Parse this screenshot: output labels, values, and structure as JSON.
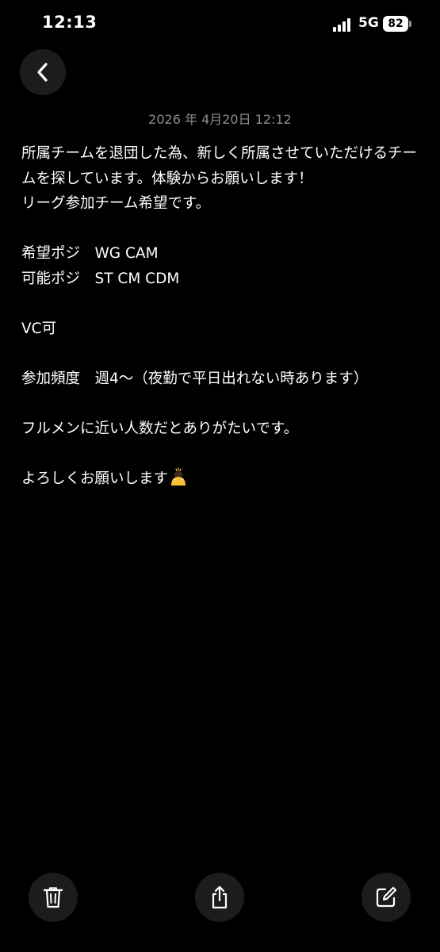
{
  "status_bar": {
    "time": "12:13",
    "network": "5G",
    "battery": "82"
  },
  "note": {
    "date": "2026 年 4月20日 12:12",
    "lines": [
      "所属チームを退団した為、新しく所属させていただけるチームを探しています。体験からお願いします！",
      "リーグ参加チーム希望です。",
      "希望ポジ　WG CAM",
      "可能ポジ　ST CM CDM",
      "VC可",
      "参加頻度　週4〜（夜勤で平日出れない時あります）",
      "フルメンに近い人数だとありがたいです。",
      "よろしくお願いします"
    ]
  },
  "icons": {
    "back": "chevron-left-icon",
    "delete": "trash-icon",
    "share": "share-icon",
    "compose": "compose-icon",
    "emoji": "person-bowing-emoji"
  },
  "colors": {
    "background": "#000000",
    "button_background": "#1c1c1e",
    "text": "#ffffff",
    "secondary_text": "#8e8e93",
    "emoji": "#f5c033"
  }
}
